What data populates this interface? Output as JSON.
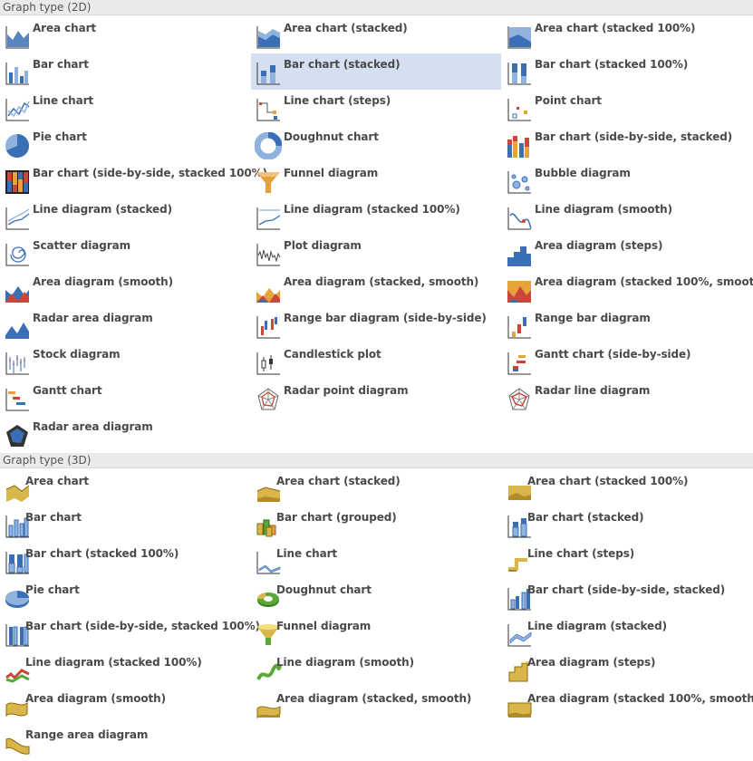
{
  "sections": [
    {
      "title": "Graph type (2D)",
      "items": [
        {
          "label": "Area chart",
          "icon": "area-chart-icon"
        },
        {
          "label": "Area chart (stacked)",
          "icon": "area-stacked-icon"
        },
        {
          "label": "Area chart (stacked 100%)",
          "icon": "area-stacked-100-icon"
        },
        {
          "label": "Bar chart",
          "icon": "bar-chart-icon"
        },
        {
          "label": "Bar chart (stacked)",
          "icon": "bar-stacked-icon",
          "selected": true
        },
        {
          "label": "Bar chart (stacked 100%)",
          "icon": "bar-stacked-100-icon"
        },
        {
          "label": "Line chart",
          "icon": "line-chart-icon"
        },
        {
          "label": "Line chart (steps)",
          "icon": "line-steps-icon"
        },
        {
          "label": "Point chart",
          "icon": "point-chart-icon"
        },
        {
          "label": "Pie chart",
          "icon": "pie-chart-icon"
        },
        {
          "label": "Doughnut chart",
          "icon": "doughnut-chart-icon"
        },
        {
          "label": "Bar chart (side-by-side, stacked)",
          "icon": "bar-side-stacked-icon"
        },
        {
          "label": "Bar chart (side-by-side, stacked 100%)",
          "icon": "bar-side-stacked-100-icon"
        },
        {
          "label": "Funnel diagram",
          "icon": "funnel-icon"
        },
        {
          "label": "Bubble diagram",
          "icon": "bubble-icon"
        },
        {
          "label": "Line diagram (stacked)",
          "icon": "line-stacked-icon"
        },
        {
          "label": "Line diagram (stacked 100%)",
          "icon": "line-stacked-100-icon"
        },
        {
          "label": "Line diagram (smooth)",
          "icon": "line-smooth-icon"
        },
        {
          "label": "Scatter diagram",
          "icon": "scatter-icon"
        },
        {
          "label": "Plot diagram",
          "icon": "plot-icon"
        },
        {
          "label": "Area diagram (steps)",
          "icon": "area-steps-icon"
        },
        {
          "label": "Area diagram (smooth)",
          "icon": "area-smooth-icon"
        },
        {
          "label": "Area diagram (stacked, smooth)",
          "icon": "area-stacked-smooth-icon"
        },
        {
          "label": "Area diagram (stacked 100%, smooth)",
          "icon": "area-stacked-100-smooth-icon"
        },
        {
          "label": "Radar area diagram",
          "icon": "radar-area-flat-icon"
        },
        {
          "label": "Range bar diagram (side-by-side)",
          "icon": "range-bar-side-icon"
        },
        {
          "label": "Range bar diagram",
          "icon": "range-bar-icon"
        },
        {
          "label": "Stock diagram",
          "icon": "stock-icon"
        },
        {
          "label": "Candlestick plot",
          "icon": "candlestick-icon"
        },
        {
          "label": "Gantt chart (side-by-side)",
          "icon": "gantt-side-icon"
        },
        {
          "label": "Gantt chart",
          "icon": "gantt-icon"
        },
        {
          "label": "Radar point diagram",
          "icon": "radar-point-icon"
        },
        {
          "label": "Radar line diagram",
          "icon": "radar-line-icon"
        },
        {
          "label": "Radar area diagram",
          "icon": "radar-area-icon"
        }
      ]
    },
    {
      "title": "Graph type (3D)",
      "items": [
        {
          "label": "Area chart",
          "icon": "area-3d-icon"
        },
        {
          "label": "Area chart (stacked)",
          "icon": "area-stacked-3d-icon"
        },
        {
          "label": "Area chart (stacked 100%)",
          "icon": "area-stacked-100-3d-icon"
        },
        {
          "label": "Bar chart",
          "icon": "bar-3d-icon"
        },
        {
          "label": "Bar chart (grouped)",
          "icon": "bar-grouped-3d-icon"
        },
        {
          "label": "Bar chart (stacked)",
          "icon": "bar-stacked-3d-icon"
        },
        {
          "label": "Bar chart (stacked 100%)",
          "icon": "bar-stacked-100-3d-icon"
        },
        {
          "label": "Line chart",
          "icon": "line-3d-icon"
        },
        {
          "label": "Line chart (steps)",
          "icon": "line-steps-3d-icon"
        },
        {
          "label": "Pie chart",
          "icon": "pie-3d-icon"
        },
        {
          "label": "Doughnut chart",
          "icon": "doughnut-3d-icon"
        },
        {
          "label": "Bar chart (side-by-side, stacked)",
          "icon": "bar-side-stacked-3d-icon"
        },
        {
          "label": "Bar chart (side-by-side, stacked 100%)",
          "icon": "bar-side-stacked-100-3d-icon"
        },
        {
          "label": "Funnel diagram",
          "icon": "funnel-3d-icon"
        },
        {
          "label": "Line diagram (stacked)",
          "icon": "line-stacked-3d-icon"
        },
        {
          "label": "Line diagram (stacked 100%)",
          "icon": "line-stacked-100-3d-icon"
        },
        {
          "label": "Line diagram (smooth)",
          "icon": "line-smooth-3d-icon"
        },
        {
          "label": "Area diagram (steps)",
          "icon": "area-steps-3d-icon"
        },
        {
          "label": "Area diagram (smooth)",
          "icon": "area-smooth-3d-icon"
        },
        {
          "label": "Area diagram (stacked, smooth)",
          "icon": "area-stacked-smooth-3d-icon"
        },
        {
          "label": "Area diagram (stacked 100%, smooth)",
          "icon": "area-stacked-100-smooth-3d-icon"
        },
        {
          "label": "Range area diagram",
          "icon": "range-area-3d-icon"
        }
      ]
    }
  ],
  "colors": {
    "blue": "#3b6fb5",
    "light_blue": "#8fb3de",
    "red": "#c8473a",
    "orange": "#e8a23a",
    "gold": "#d9b64a",
    "green": "#5aa836",
    "selection": "#d4e0f2",
    "header_bg": "#eaeaea"
  }
}
